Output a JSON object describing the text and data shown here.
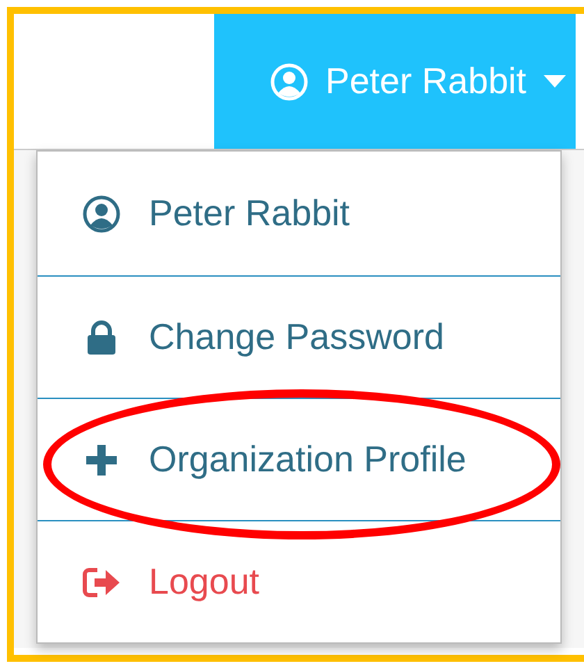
{
  "navbar": {
    "user_button": {
      "label": "Peter Rabbit",
      "expanded": true
    }
  },
  "dropdown": {
    "items": [
      {
        "kind": "profile",
        "label": "Peter Rabbit",
        "circled": false
      },
      {
        "kind": "password",
        "label": "Change Password",
        "circled": false
      },
      {
        "kind": "organization",
        "label": "Organization Profile",
        "circled": true
      },
      {
        "kind": "logout",
        "label": "Logout",
        "circled": false
      }
    ]
  }
}
